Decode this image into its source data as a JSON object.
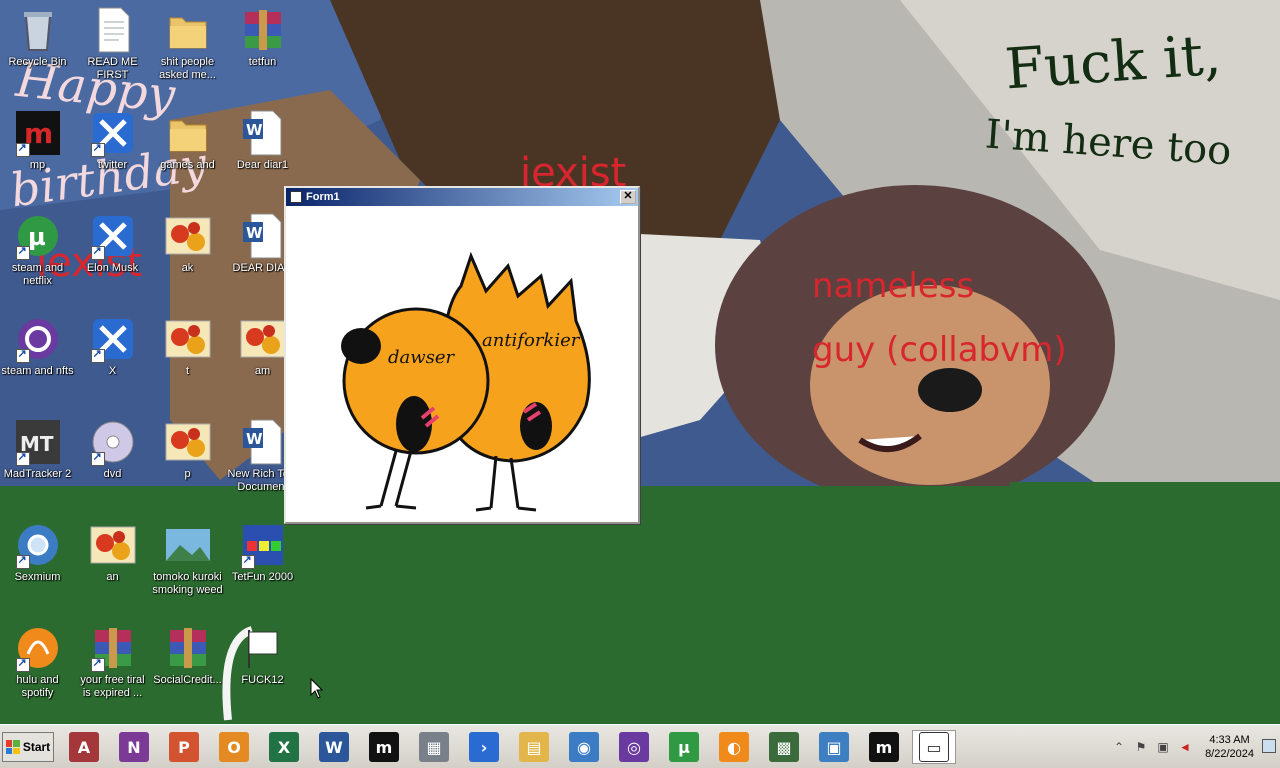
{
  "wallpaper": {
    "text_happy": "Happy",
    "text_birthday": "birthday",
    "text_iexist_top": "iexist",
    "text_iexist_left": "iexist",
    "text_fuck_it": "Fuck it,",
    "text_here_too": "I'm here too",
    "text_nameless": "nameless",
    "text_guy": "guy (collabvm)"
  },
  "desktop": {
    "icons": [
      {
        "label": "Recycle Bin",
        "icon": "recycle-bin-icon"
      },
      {
        "label": "READ ME FIRST",
        "icon": "text-document-icon"
      },
      {
        "label": "shit people asked me...",
        "icon": "folder-icon"
      },
      {
        "label": "tetfun",
        "icon": "winrar-archive-icon"
      },
      {
        "label": "mp",
        "icon": "mp-app-icon"
      },
      {
        "label": "twitter",
        "icon": "x-app-icon"
      },
      {
        "label": "games and",
        "icon": "folder-icon"
      },
      {
        "label": "Dear diar1",
        "icon": "word-document-icon"
      },
      {
        "label": "steam and netflix",
        "icon": "utorrent-icon"
      },
      {
        "label": "Elon Musk",
        "icon": "x-app-icon"
      },
      {
        "label": "ak",
        "icon": "flower-image-icon"
      },
      {
        "label": "DEAR DIAR",
        "icon": "word-document-icon"
      },
      {
        "label": "steam and nfts",
        "icon": "bittorrent-icon"
      },
      {
        "label": "X",
        "icon": "x-app-icon"
      },
      {
        "label": "t",
        "icon": "flower-image-icon"
      },
      {
        "label": "am",
        "icon": "flower-image-icon"
      },
      {
        "label": "MadTracker 2",
        "icon": "madtracker-icon"
      },
      {
        "label": "dvd",
        "icon": "dvd-icon"
      },
      {
        "label": "p",
        "icon": "flower-image-icon"
      },
      {
        "label": "New Rich Text Document",
        "icon": "word-document-icon"
      },
      {
        "label": "Sexmium",
        "icon": "chromium-icon"
      },
      {
        "label": "an",
        "icon": "flower-image-icon"
      },
      {
        "label": "tomoko kuroki smoking weed",
        "icon": "landscape-image-icon"
      },
      {
        "label": "TetFun 2000",
        "icon": "tetfun-icon"
      },
      {
        "label": "hulu and spotify",
        "icon": "bitcomet-icon"
      },
      {
        "label": "your free tiral is expired ...",
        "icon": "winrar-archive-icon"
      },
      {
        "label": "SocialCredit...",
        "icon": "winrar-archive-icon"
      },
      {
        "label": "FUCK12",
        "icon": "flag-icon"
      }
    ]
  },
  "form1": {
    "title": "Form1",
    "close_label": "✕",
    "label_left": "dawser",
    "label_right": "antiforkier"
  },
  "taskbar": {
    "start_label": "Start",
    "items": [
      {
        "icon": "access-icon",
        "glyph": "A",
        "color": "#a4373a"
      },
      {
        "icon": "onenote-icon",
        "glyph": "N",
        "color": "#7b3a96"
      },
      {
        "icon": "powerpoint-icon",
        "glyph": "P",
        "color": "#d35230"
      },
      {
        "icon": "outlook-icon",
        "glyph": "O",
        "color": "#e48a22"
      },
      {
        "icon": "excel-icon",
        "glyph": "X",
        "color": "#217346"
      },
      {
        "icon": "word-icon",
        "glyph": "W",
        "color": "#2b579a"
      },
      {
        "icon": "mp-app-icon",
        "glyph": "m",
        "color": "#111111"
      },
      {
        "icon": "computer-icon",
        "glyph": "▦",
        "color": "#7a8089"
      },
      {
        "icon": "powershell-icon",
        "glyph": "›",
        "color": "#2a6bd1"
      },
      {
        "icon": "file-explorer-icon",
        "glyph": "▤",
        "color": "#e2b64a"
      },
      {
        "icon": "chromium-icon",
        "glyph": "◉",
        "color": "#3b7cc4"
      },
      {
        "icon": "bittorrent-icon",
        "glyph": "◎",
        "color": "#6a3aa0"
      },
      {
        "icon": "utorrent-icon",
        "glyph": "µ",
        "color": "#2f9a43"
      },
      {
        "icon": "bitcomet-icon",
        "glyph": "◐",
        "color": "#f08a1a"
      },
      {
        "icon": "task-manager-icon",
        "glyph": "▩",
        "color": "#3a6b3a"
      },
      {
        "icon": "control-panel-icon",
        "glyph": "▣",
        "color": "#3d7fc1"
      },
      {
        "icon": "mp-app-icon",
        "glyph": "m",
        "color": "#111111"
      },
      {
        "icon": "form-window-icon",
        "glyph": "▭",
        "color": "#ffffff"
      }
    ]
  },
  "tray": {
    "time": "4:33 AM",
    "date": "8/22/2024"
  }
}
